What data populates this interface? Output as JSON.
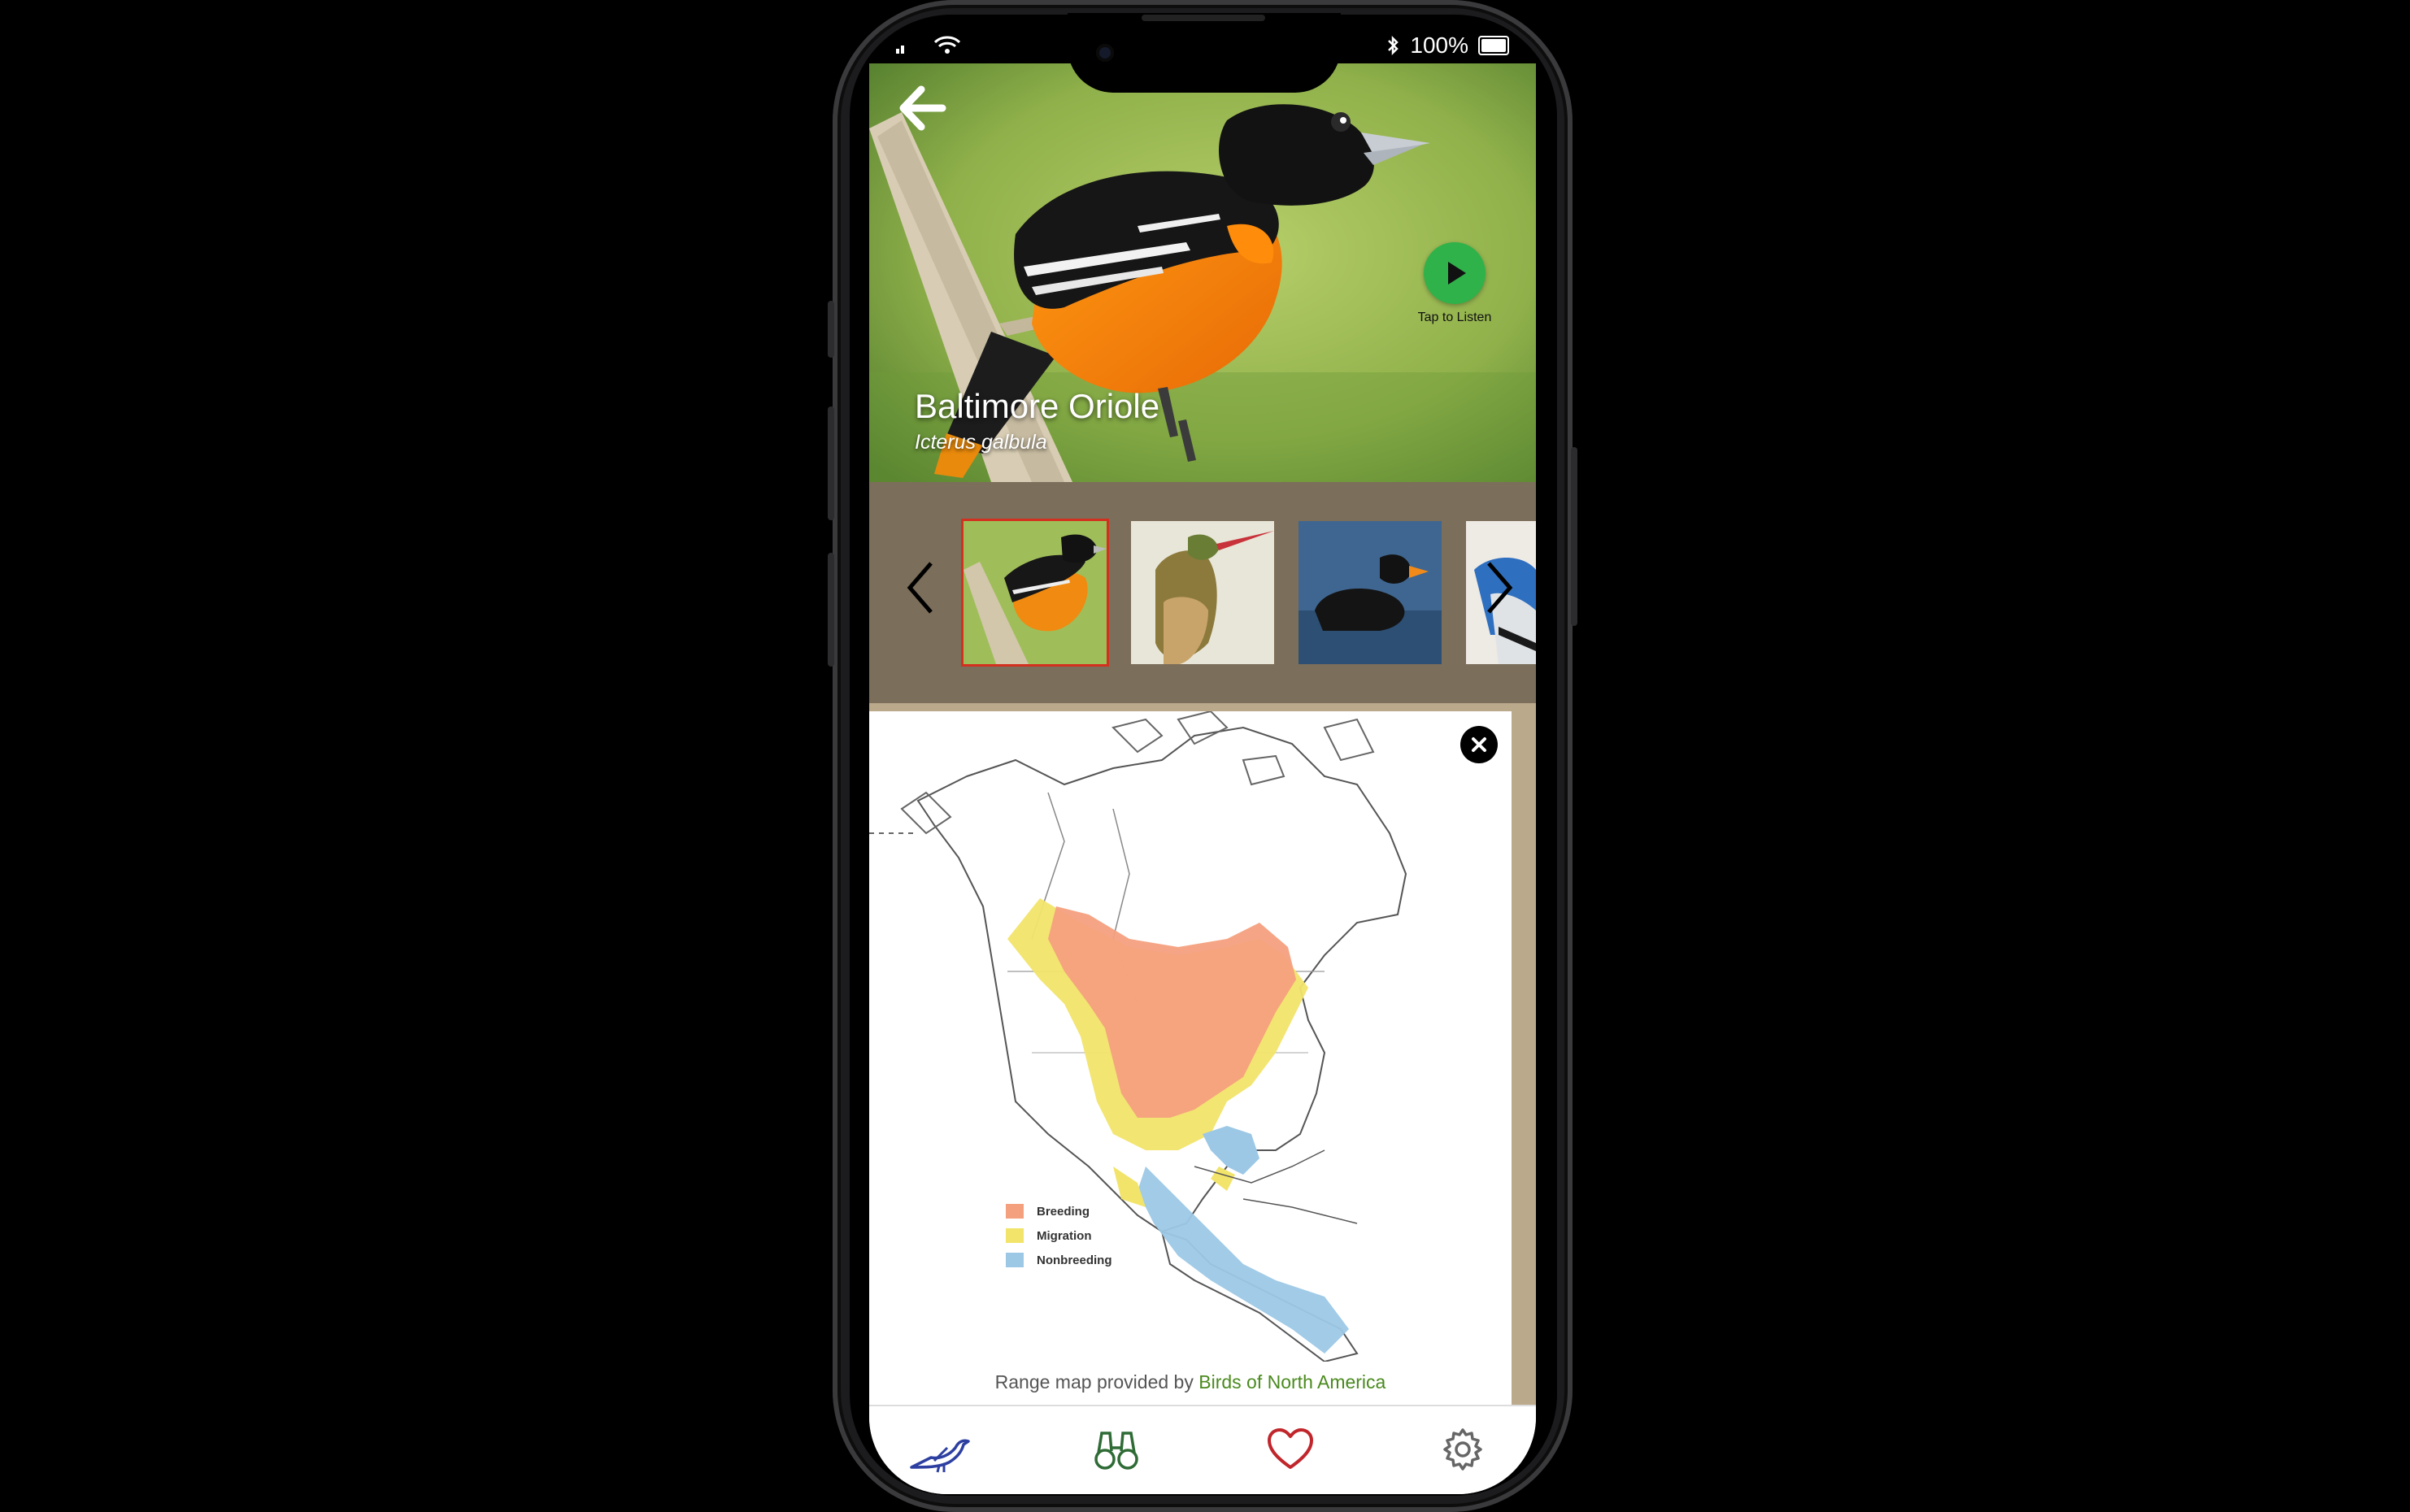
{
  "status": {
    "battery": "100%"
  },
  "bird": {
    "common_name": "Baltimore Oriole",
    "scientific_name": "Icterus galbula"
  },
  "listen": {
    "label": "Tap to Listen"
  },
  "gallery": {
    "thumbnails": [
      {
        "name": "Baltimore Oriole",
        "selected": true
      },
      {
        "name": "Hummingbird",
        "selected": false
      },
      {
        "name": "Scoter",
        "selected": false
      },
      {
        "name": "Blue Jay",
        "selected": false
      }
    ]
  },
  "map": {
    "legend": [
      "Breeding",
      "Migration",
      "Nonbreeding"
    ],
    "legend_colors": [
      "#f4a07e",
      "#f2e46a",
      "#9cc8e6"
    ],
    "credit_prefix": "Range map provided by ",
    "credit_link": "Birds of North America"
  },
  "tabs": [
    {
      "icon": "bird-icon",
      "color": "#2d3fa0"
    },
    {
      "icon": "binoculars-icon",
      "color": "#2e6b35"
    },
    {
      "icon": "heart-icon",
      "color": "#c0262b"
    },
    {
      "icon": "gear-icon",
      "color": "#666"
    }
  ]
}
